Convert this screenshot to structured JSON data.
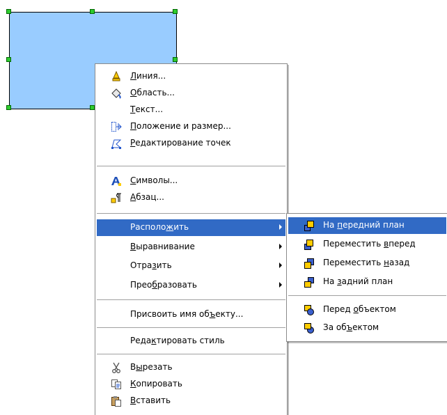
{
  "main_menu": {
    "items": [
      {
        "id": "line",
        "before": "",
        "key": "Л",
        "after": "иния...",
        "icon": "line-icon"
      },
      {
        "id": "area",
        "before": "",
        "key": "О",
        "after": "бласть...",
        "icon": "area-icon"
      },
      {
        "id": "text",
        "before": "",
        "key": "Т",
        "after": "екст...",
        "icon": ""
      },
      {
        "id": "position-size",
        "before": "",
        "key": "П",
        "after": "оложение и размер...",
        "icon": "position-size-icon"
      },
      {
        "id": "edit-points",
        "before": "",
        "key": "Р",
        "after": "едактирование точек",
        "icon": "edit-points-icon"
      },
      {
        "id": "characters",
        "before": "",
        "key": "С",
        "after": "имволы...",
        "icon": "characters-icon"
      },
      {
        "id": "paragraph",
        "before": "",
        "key": "А",
        "after": "бзац...",
        "icon": "paragraph-icon"
      },
      {
        "id": "arrange",
        "before": "Располо",
        "key": "ж",
        "after": "ить",
        "icon": ""
      },
      {
        "id": "alignment",
        "before": "",
        "key": "В",
        "after": "ыравнивание",
        "icon": ""
      },
      {
        "id": "flip",
        "before": "Отра",
        "key": "з",
        "after": "ить",
        "icon": ""
      },
      {
        "id": "convert",
        "before": "Прео",
        "key": "б",
        "after": "разовать",
        "icon": ""
      },
      {
        "id": "name-object",
        "before": "Присвоить имя об",
        "key": "ъ",
        "after": "екту...",
        "icon": ""
      },
      {
        "id": "edit-style",
        "before": "Реда",
        "key": "к",
        "after": "тировать стиль",
        "icon": ""
      },
      {
        "id": "cut",
        "before": "В",
        "key": "ы",
        "after": "резать",
        "icon": "scissors-icon"
      },
      {
        "id": "copy",
        "before": "",
        "key": "К",
        "after": "опировать",
        "icon": "copy-icon"
      },
      {
        "id": "paste",
        "before": "",
        "key": "В",
        "after": "ставить",
        "icon": "paste-icon"
      }
    ]
  },
  "sub_menu": {
    "items": [
      {
        "id": "bring-to-front",
        "before": "На ",
        "key": "п",
        "after": "ередний план",
        "icon": "bring-to-front-icon"
      },
      {
        "id": "bring-forward",
        "before": "Переместить ",
        "key": "в",
        "after": "перед",
        "icon": "bring-forward-icon"
      },
      {
        "id": "send-backward",
        "before": "Переместить ",
        "key": "н",
        "after": "азад",
        "icon": "send-backward-icon"
      },
      {
        "id": "send-to-back",
        "before": "На ",
        "key": "з",
        "after": "адний план",
        "icon": "send-to-back-icon"
      },
      {
        "id": "in-front-of-object",
        "before": "Перед ",
        "key": "о",
        "after": "бъектом",
        "icon": "in-front-of-object-icon"
      },
      {
        "id": "behind-object",
        "before": "За об",
        "key": "ъ",
        "after": "ектом",
        "icon": "behind-object-icon"
      }
    ]
  },
  "colors": {
    "highlight": "#316ac5",
    "shape_fill": "#99ccff",
    "handle": "#2ecc2e"
  }
}
